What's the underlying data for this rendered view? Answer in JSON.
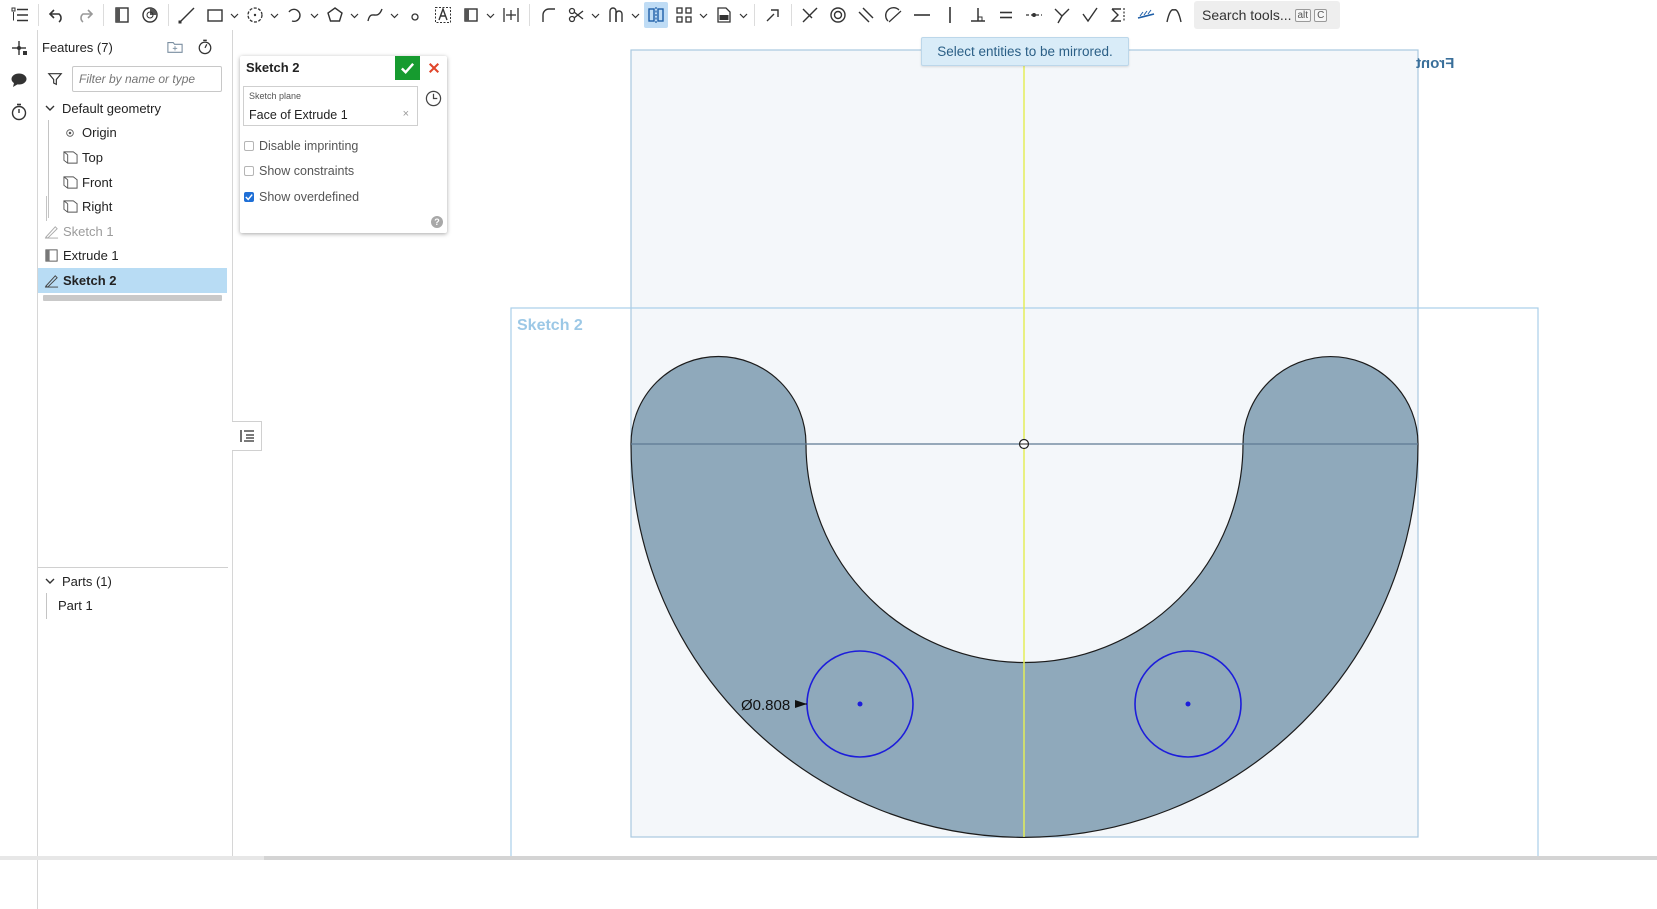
{
  "toolbar": {
    "search_label": "Search tools...",
    "search_key1": "alt",
    "search_key2": "C",
    "active_tool": "mirror-icon"
  },
  "features": {
    "title": "Features (7)",
    "filter_placeholder": "Filter by name or type",
    "default_geometry": "Default geometry",
    "items": [
      {
        "label": "Origin",
        "icon": "origin-icon"
      },
      {
        "label": "Top",
        "icon": "plane-icon"
      },
      {
        "label": "Front",
        "icon": "plane-icon"
      },
      {
        "label": "Right",
        "icon": "plane-icon"
      },
      {
        "label": "Sketch 1",
        "icon": "sketch-icon",
        "state": "dim"
      },
      {
        "label": "Extrude 1",
        "icon": "extrude-icon"
      },
      {
        "label": "Sketch 2",
        "icon": "sketch-icon",
        "state": "selected"
      }
    ],
    "parts_title": "Parts (1)",
    "parts": [
      {
        "label": "Part 1"
      }
    ]
  },
  "dialog": {
    "title": "Sketch 2",
    "plane_label": "Sketch plane",
    "plane_value": "Face of Extrude 1",
    "clear_glyph": "×",
    "options": [
      {
        "label": "Disable imprinting",
        "checked": false
      },
      {
        "label": "Show constraints",
        "checked": false
      },
      {
        "label": "Show overdefined",
        "checked": true
      }
    ],
    "help_glyph": "?"
  },
  "canvas": {
    "tooltip": "Select entities to be mirrored.",
    "plane_label": "Front",
    "sketch_label": "Sketch 2",
    "dimension": "Ø0.808",
    "colors": {
      "part_fill": "#8fa9bb",
      "sketch_outline": "#a5cde6",
      "circle": "#1d1ddb",
      "mirror_line": "#e4ee5a",
      "background_plane": "#f4f7fa"
    }
  }
}
